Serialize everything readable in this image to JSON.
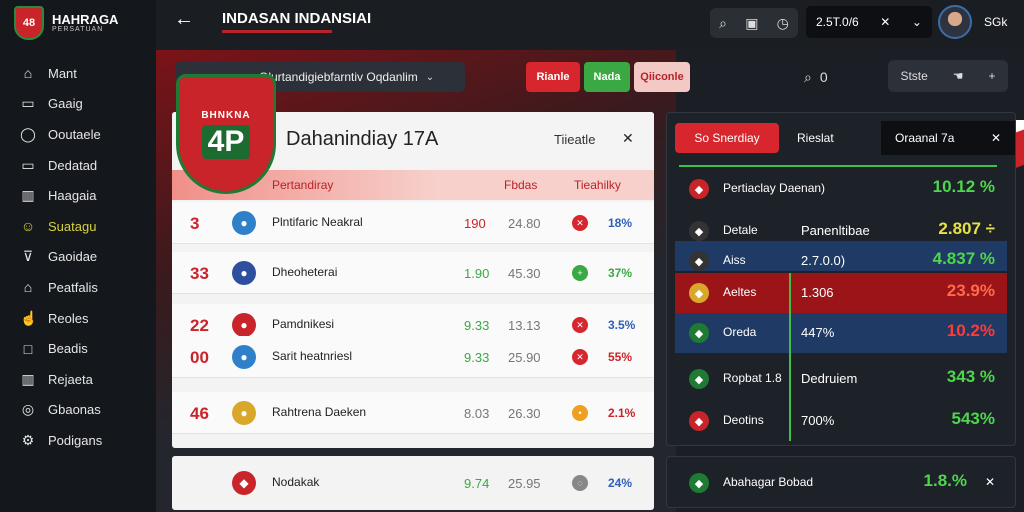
{
  "brand": {
    "title": "HAHRAGA",
    "subtitle": "PERSATUAN",
    "logo_text": "48"
  },
  "sidebar": {
    "items": [
      {
        "label": "Mant",
        "icon": "home-icon"
      },
      {
        "label": "Gaaig",
        "icon": "monitor-icon"
      },
      {
        "label": "Ooutaele",
        "icon": "circle-icon"
      },
      {
        "label": "Dedatad",
        "icon": "monitor-icon"
      },
      {
        "label": "Haagaia",
        "icon": "chart-icon"
      },
      {
        "label": "Suatagu",
        "icon": "smile-icon"
      },
      {
        "label": "Gaoidae",
        "icon": "filter-icon"
      },
      {
        "label": "Peatfalis",
        "icon": "home-icon"
      },
      {
        "label": "Reoles",
        "icon": "hand-icon"
      },
      {
        "label": "Beadis",
        "icon": "square-icon"
      },
      {
        "label": "Rejaeta",
        "icon": "chart-icon"
      },
      {
        "label": "Gbaonas",
        "icon": "target-icon"
      },
      {
        "label": "Podigans",
        "icon": "gear-icon"
      }
    ],
    "active_index": 5
  },
  "topbar": {
    "title": "INDASAN INDANSIAI",
    "search_value": "2.5T.0/6",
    "user": "SGk"
  },
  "toolbar": {
    "dropdown_value": "Olurtandigiebfarntiv Oqdanlim",
    "btn_red": "Rianle",
    "btn_green": "Nada",
    "btn_pink": "Qiiconle",
    "zoom_value": "0",
    "right_label": "Stste"
  },
  "crest": {
    "top": "BHNKNA",
    "main": "4P"
  },
  "match_card": {
    "title": "Dahanindiay 17A",
    "subtitle_right": "Tiieatle",
    "columns": {
      "team": "Pertandiray",
      "value": "Fbdas",
      "trend": "Tieahilky"
    },
    "rows": [
      {
        "num": "3",
        "team": "Plntifaric Neakral",
        "v1": "190",
        "v2": "24.80",
        "pct": "18%",
        "logo_color": "#2f80c8",
        "dot_color": "#d7262d",
        "dot": "✕",
        "v1_color": "#c8242a",
        "pct_color": "#2f5fb8"
      },
      {
        "num": "33",
        "team": "Dheoheterai",
        "v1": "1.90",
        "v2": "45.30",
        "pct": "37%",
        "logo_color": "#2d4f9e",
        "dot_color": "#3aa843",
        "dot": "+",
        "v1_color": "#3aa843",
        "pct_color": "#3aa843"
      },
      {
        "num": "22",
        "team": "Pamdnikesi",
        "v1": "9.33",
        "v2": "13.13",
        "pct": "3.5%",
        "logo_color": "#c8242a",
        "dot_color": "#d7262d",
        "dot": "✕",
        "v1_color": "#3aa843",
        "pct_color": "#2f5fb8"
      },
      {
        "num": "00",
        "team": "Sarit heatnriesl",
        "v1": "9.33",
        "v2": "25.90",
        "pct": "55%",
        "logo_color": "#2f80c8",
        "dot_color": "#d7262d",
        "dot": "✕",
        "v1_color": "#3aa843",
        "pct_color": "#c8242a"
      },
      {
        "num": "46",
        "team": "Rahtrena Daeken",
        "v1": "8.03",
        "v2": "26.30",
        "pct": "2.1%",
        "logo_color": "#d9a82b",
        "dot_color": "#f0a020",
        "dot": "•",
        "v1_color": "#777777",
        "pct_color": "#c8242a"
      }
    ],
    "bottom_row": {
      "team": "Nodakak",
      "v1": "9.74",
      "v2": "25.95",
      "pct": "24%"
    }
  },
  "stats_panel": {
    "tab_active": "So Snerdiay",
    "tab_2": "Rieslat",
    "tab_dark": "Oraanal 7a",
    "rows": [
      {
        "label": "Pertiaclay Daenan)",
        "mid": "",
        "value": "10.12 %"
      },
      {
        "label": "Detale",
        "mid": "Panenltibae",
        "value": "2.807 ÷"
      },
      {
        "label": "Aiss",
        "mid": "2.7.0.0)",
        "value": "4.837 %"
      },
      {
        "label": "Aeltes",
        "mid": "1.306",
        "value": "23.9%"
      },
      {
        "label": "Oreda",
        "mid": "447%",
        "value": "10.2%"
      },
      {
        "label": "Ropbat 1.8",
        "mid": "Dedruiem",
        "value": "343 %"
      },
      {
        "label": "Deotins",
        "mid": "700%",
        "value": "543%"
      }
    ],
    "bottom": {
      "label": "Abahagar Bobad",
      "value": "1.8.%"
    }
  }
}
